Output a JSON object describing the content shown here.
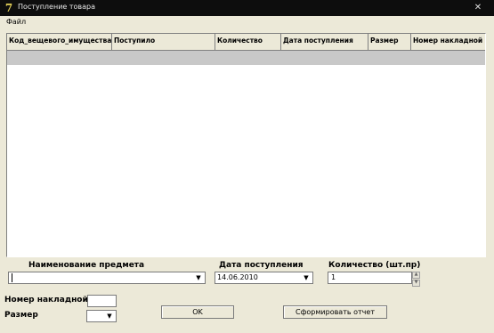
{
  "window": {
    "title": "Поступление товара",
    "close_glyph": "✕",
    "app_icon_glyph": "7"
  },
  "menu": {
    "file": "Файл"
  },
  "grid": {
    "columns": [
      "Код_вещевого_имущества",
      "Поступило",
      "Количество",
      "Дата поступления",
      "Размер",
      "Номер накладной"
    ]
  },
  "form": {
    "item_name_label": "Наименование предмета",
    "item_name_value": "",
    "date_label": "Дата поступления",
    "date_value": "14.06.2010",
    "qty_label": "Количество (шт.пр)",
    "qty_value": "1",
    "invoice_label": "Номер накладной",
    "invoice_value": "",
    "size_label": "Размер",
    "size_value": "",
    "ok_label": "OK",
    "report_label": "Сформировать отчет"
  }
}
